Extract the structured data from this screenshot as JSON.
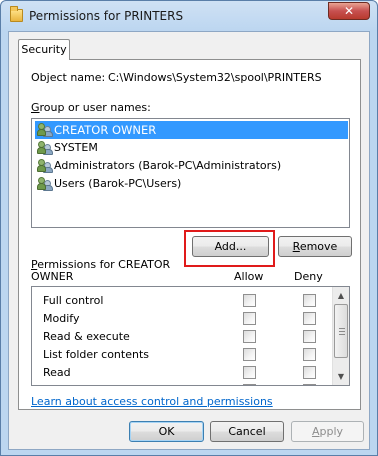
{
  "window": {
    "title": "Permissions for PRINTERS",
    "close_glyph": "✕"
  },
  "tabs": [
    {
      "label": "Security"
    }
  ],
  "object": {
    "label": "Object name:",
    "value": "C:\\Windows\\System32\\spool\\PRINTERS"
  },
  "groups": {
    "label": "Group or user names:",
    "items": [
      {
        "name": "CREATOR OWNER",
        "selected": true
      },
      {
        "name": "SYSTEM"
      },
      {
        "name": "Administrators (Barok-PC\\Administrators)"
      },
      {
        "name": "Users (Barok-PC\\Users)"
      }
    ]
  },
  "buttons": {
    "add": "Add...",
    "remove": "Remove",
    "ok": "OK",
    "cancel": "Cancel",
    "apply": "Apply"
  },
  "permissions": {
    "label_line1": "Permissions for CREATOR",
    "label_line2": "OWNER",
    "allow_header": "Allow",
    "deny_header": "Deny",
    "rows": [
      {
        "name": "Full control",
        "allow": false,
        "deny": false
      },
      {
        "name": "Modify",
        "allow": false,
        "deny": false
      },
      {
        "name": "Read & execute",
        "allow": false,
        "deny": false
      },
      {
        "name": "List folder contents",
        "allow": false,
        "deny": false
      },
      {
        "name": "Read",
        "allow": false,
        "deny": false
      }
    ]
  },
  "link": "Learn about access control and permissions",
  "icons": {
    "title": "folder-icon",
    "user": "user-group-icon",
    "scroll_up": "▲",
    "scroll_down": "▼"
  }
}
